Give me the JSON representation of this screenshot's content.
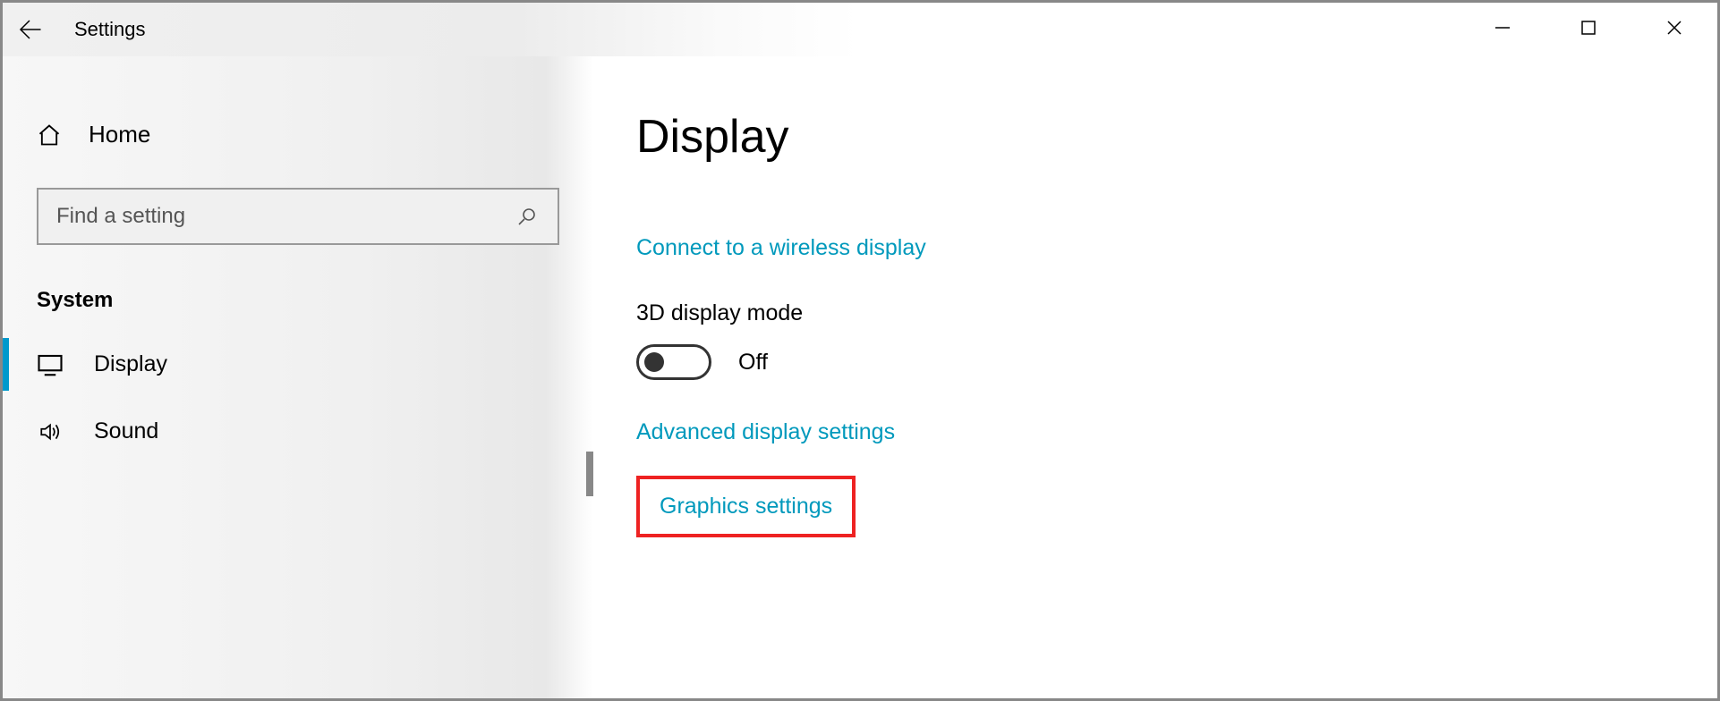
{
  "window": {
    "title": "Settings"
  },
  "sidebar": {
    "home_label": "Home",
    "search_placeholder": "Find a setting",
    "category_label": "System",
    "items": [
      {
        "icon": "display-icon",
        "label": "Display",
        "selected": true
      },
      {
        "icon": "sound-icon",
        "label": "Sound",
        "selected": false
      }
    ]
  },
  "content": {
    "page_title": "Display",
    "link_wireless": "Connect to a wireless display",
    "subheading_3d": "3D display mode",
    "toggle_3d_state": "Off",
    "link_advanced": "Advanced display settings",
    "link_graphics": "Graphics settings"
  }
}
